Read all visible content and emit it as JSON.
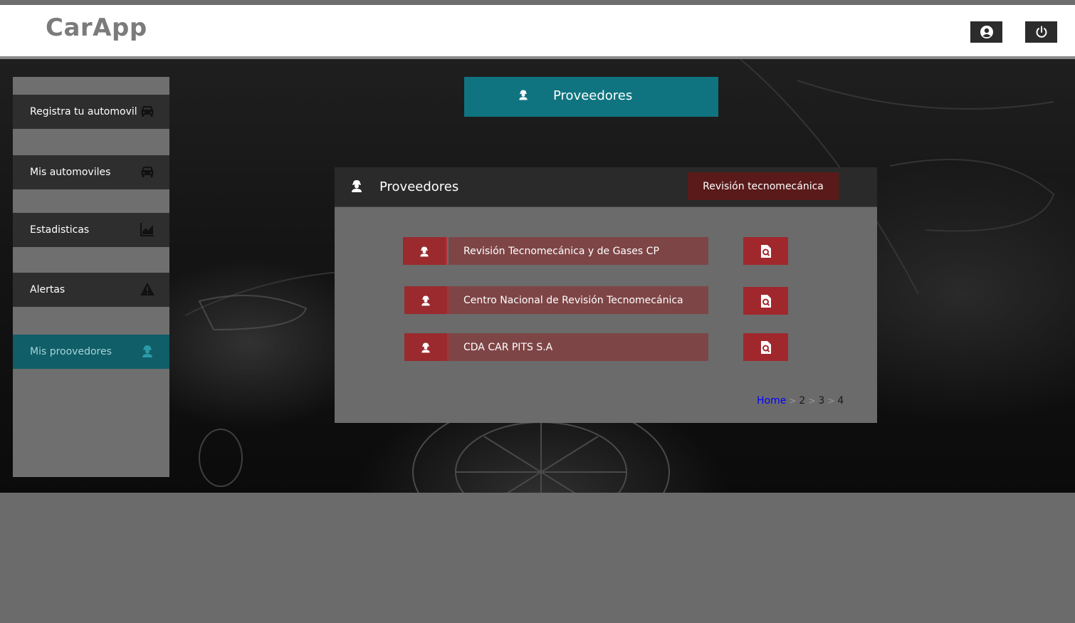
{
  "header": {
    "brand": "CarApp",
    "profile_icon": "user-circle-icon",
    "power_icon": "power-icon"
  },
  "sidebar": {
    "items": [
      {
        "label": "Registra tu automovil",
        "icon": "car-icon"
      },
      {
        "label": "Mis automoviles",
        "icon": "car-icon"
      },
      {
        "label": "Estadisticas",
        "icon": "chart-area-icon"
      },
      {
        "label": "Alertas",
        "icon": "warning-icon"
      },
      {
        "label": "Mis proovedores",
        "icon": "worker-icon",
        "active": true
      }
    ]
  },
  "banner": {
    "label": "Proveedores",
    "icon": "worker-icon"
  },
  "panel": {
    "title": "Proveedores",
    "filter_button": "Revisión tecnomecánica",
    "providers": [
      {
        "name": "Revisión Tecnomecánica y de Gases CP"
      },
      {
        "name": "Centro Nacional de Revisión Tecnomecánica"
      },
      {
        "name": "CDA CAR PITS S.A"
      }
    ],
    "breadcrumb": {
      "home": "Home",
      "separator": ">",
      "pages": [
        "2",
        "3",
        "4"
      ]
    }
  },
  "colors": {
    "accent_teal": "#0f7480",
    "active_sidebar": "#0f5e68",
    "provider_red": "#a0282c",
    "filter_dark_red": "#5a1a1a"
  }
}
